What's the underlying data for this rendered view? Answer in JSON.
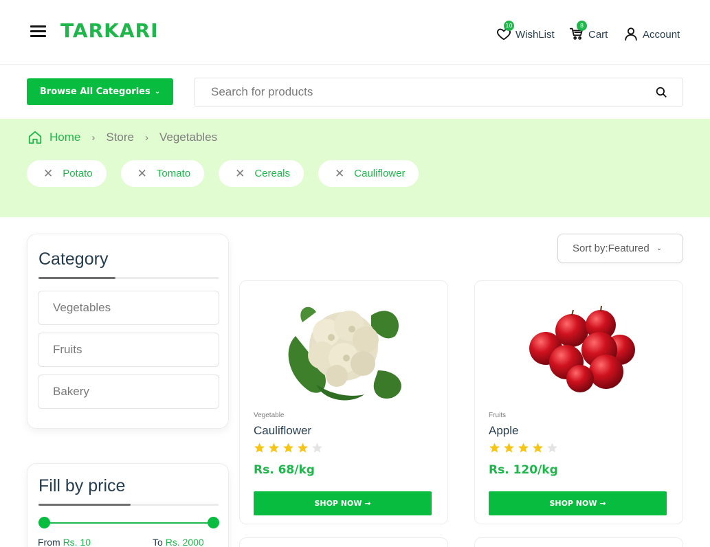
{
  "header": {
    "logo": "TARKARI",
    "wishlist": {
      "label": "WishList",
      "count": "10"
    },
    "cart": {
      "label": "Cart",
      "count": "8"
    },
    "account": {
      "label": "Account"
    }
  },
  "toolbar": {
    "browse_label": "Browse All Categories",
    "search_placeholder": "Search for products"
  },
  "breadcrumb": {
    "home": "Home",
    "items": [
      "Store",
      "Vegetables"
    ]
  },
  "filter_tags": [
    "Potato",
    "Tomato",
    "Cereals",
    "Cauliflower"
  ],
  "sidebar": {
    "category_title": "Category",
    "categories": [
      "Vegetables",
      "Fruits",
      "Bakery"
    ],
    "price_title": "Fill by price",
    "price_from_label": "From",
    "price_from_value": "Rs. 10",
    "price_to_label": "To",
    "price_to_value": "Rs. 2000"
  },
  "sort": {
    "label": "Sort by:Featured"
  },
  "products": [
    {
      "category": "Vegetable",
      "name": "Cauliflower",
      "rating": 4,
      "price": "Rs. 68/kg",
      "button": "SHOP NOW →"
    },
    {
      "category": "Fruits",
      "name": "Apple",
      "rating": 4,
      "price": "Rs. 120/kg",
      "button": "SHOP NOW →"
    }
  ],
  "colors": {
    "brand_green": "#1fb74b",
    "button_green": "#07bc3e",
    "band_bg": "#e2fcd1",
    "star": "#f5c518"
  }
}
